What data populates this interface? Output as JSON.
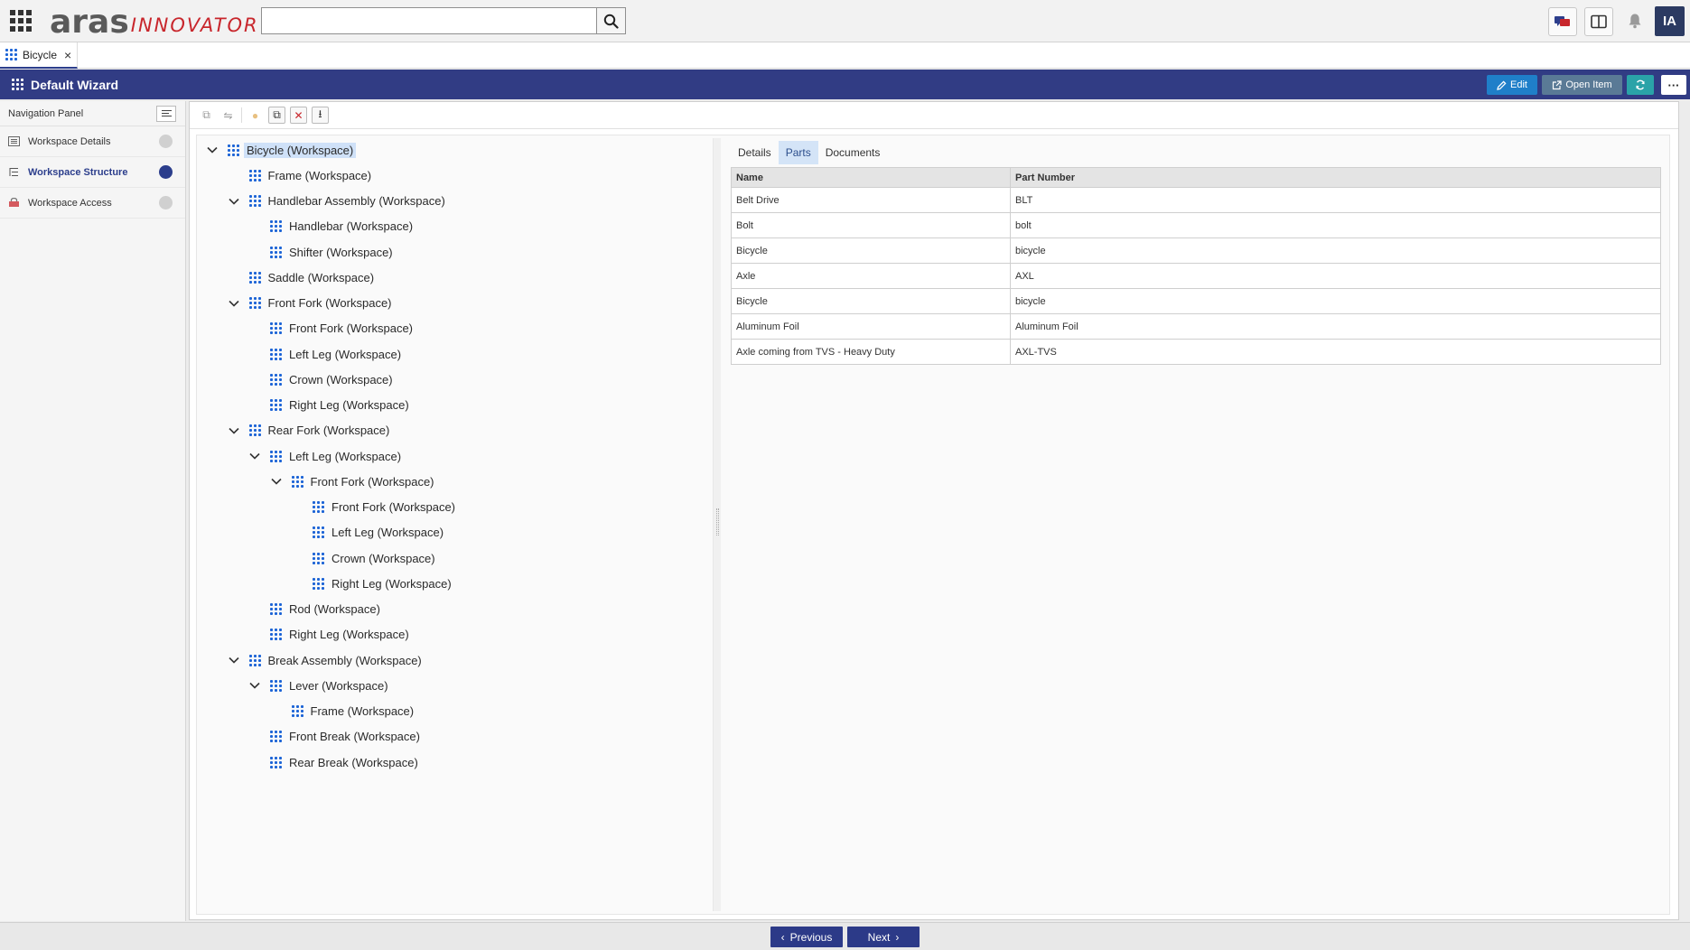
{
  "header": {
    "logo_primary": "aras",
    "logo_secondary": "INNOVATOR",
    "search": {
      "value": "",
      "placeholder": ""
    },
    "avatar_initials": "IA",
    "icons": [
      "apps-grid-icon",
      "search-icon",
      "chat-icon",
      "split-view-icon",
      "bell-icon"
    ]
  },
  "tabs": [
    {
      "label": "Bicycle",
      "close": "×"
    }
  ],
  "wizard": {
    "title": "Default Wizard",
    "actions": {
      "edit": "Edit",
      "open_item": "Open Item"
    }
  },
  "nav": {
    "title": "Navigation Panel",
    "items": [
      {
        "label": "Workspace Details",
        "status": "incomplete"
      },
      {
        "label": "Workspace Structure",
        "status": "current"
      },
      {
        "label": "Workspace Access",
        "status": "incomplete"
      }
    ]
  },
  "tree": [
    {
      "label": "Bicycle (Workspace)",
      "depth": 0,
      "expanded": true,
      "selected": true
    },
    {
      "label": "Frame (Workspace)",
      "depth": 1
    },
    {
      "label": "Handlebar Assembly (Workspace)",
      "depth": 1,
      "expanded": true
    },
    {
      "label": "Handlebar (Workspace)",
      "depth": 2
    },
    {
      "label": "Shifter (Workspace)",
      "depth": 2
    },
    {
      "label": "Saddle (Workspace)",
      "depth": 1
    },
    {
      "label": "Front Fork (Workspace)",
      "depth": 1,
      "expanded": true
    },
    {
      "label": "Front Fork (Workspace)",
      "depth": 2
    },
    {
      "label": "Left Leg (Workspace)",
      "depth": 2
    },
    {
      "label": "Crown (Workspace)",
      "depth": 2
    },
    {
      "label": "Right Leg (Workspace)",
      "depth": 2
    },
    {
      "label": "Rear Fork (Workspace)",
      "depth": 1,
      "expanded": true
    },
    {
      "label": "Left Leg (Workspace)",
      "depth": 2,
      "expanded": true
    },
    {
      "label": "Front Fork (Workspace)",
      "depth": 3,
      "expanded": true
    },
    {
      "label": "Front Fork (Workspace)",
      "depth": 4
    },
    {
      "label": "Left Leg (Workspace)",
      "depth": 4
    },
    {
      "label": "Crown (Workspace)",
      "depth": 4
    },
    {
      "label": "Right Leg (Workspace)",
      "depth": 4
    },
    {
      "label": "Rod (Workspace)",
      "depth": 2
    },
    {
      "label": "Right Leg (Workspace)",
      "depth": 2
    },
    {
      "label": "Break Assembly (Workspace)",
      "depth": 1,
      "expanded": true
    },
    {
      "label": "Lever (Workspace)",
      "depth": 2,
      "expanded": true
    },
    {
      "label": "Frame (Workspace)",
      "depth": 3
    },
    {
      "label": "Front Break (Workspace)",
      "depth": 2
    },
    {
      "label": "Rear Break (Workspace)",
      "depth": 2
    }
  ],
  "detail_tabs": [
    {
      "label": "Details",
      "active": false
    },
    {
      "label": "Parts",
      "active": true
    },
    {
      "label": "Documents",
      "active": false
    }
  ],
  "parts_table": {
    "columns": [
      "Name",
      "Part Number"
    ],
    "rows": [
      [
        "Belt Drive",
        "BLT"
      ],
      [
        "Bolt",
        "bolt"
      ],
      [
        "Bicycle",
        "bicycle"
      ],
      [
        "Axle",
        "AXL"
      ],
      [
        "Bicycle",
        "bicycle"
      ],
      [
        "Aluminum Foil",
        "Aluminum Foil"
      ],
      [
        "Axle coming from TVS - Heavy Duty",
        "AXL-TVS"
      ]
    ]
  },
  "footer": {
    "previous": "Previous",
    "next": "Next"
  },
  "colors": {
    "brand_navy": "#313c84",
    "brand_red": "#c8262c",
    "edit_button": "#1f7fc9",
    "open_item_button": "#5a7a96",
    "refresh_button": "#2aa3a8",
    "tree_icon": "#1c64d6",
    "selection": "#cfe1f8"
  }
}
